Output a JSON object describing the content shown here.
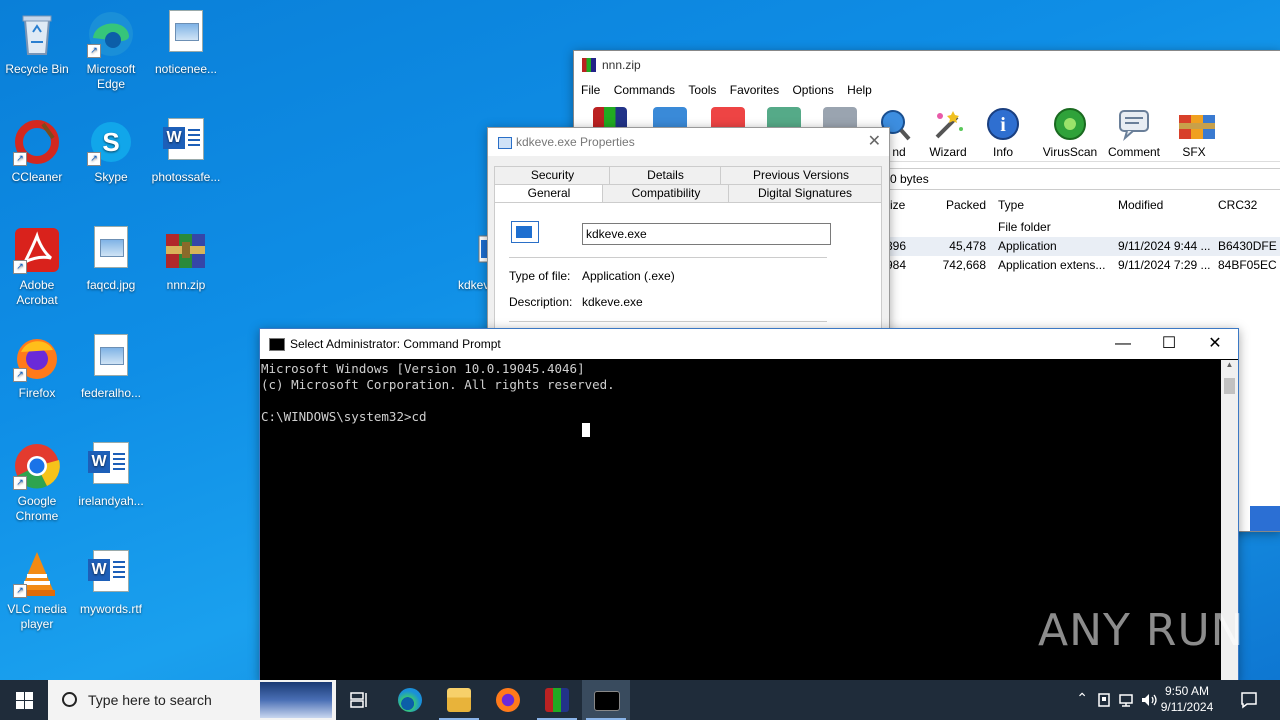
{
  "desktop": {
    "icons": [
      {
        "label": "Recycle Bin"
      },
      {
        "label": "Microsoft Edge"
      },
      {
        "label": "noticenee..."
      },
      {
        "label": "CCleaner"
      },
      {
        "label": "Skype"
      },
      {
        "label": "photossafe..."
      },
      {
        "label": "Adobe Acrobat"
      },
      {
        "label": "faqcd.jpg"
      },
      {
        "label": "nnn.zip"
      },
      {
        "label": "Firefox"
      },
      {
        "label": "federalho..."
      },
      {
        "label": "Google Chrome"
      },
      {
        "label": "irelandyah..."
      },
      {
        "label": "VLC media player"
      },
      {
        "label": "mywords.rtf"
      },
      {
        "label": "kdkev"
      }
    ]
  },
  "winrar": {
    "title": "nnn.zip",
    "menu": [
      "File",
      "Commands",
      "Tools",
      "Favorites",
      "Options",
      "Help"
    ],
    "toolbar": [
      {
        "label": "nd",
        "icon": "find-icon"
      },
      {
        "label": "Wizard",
        "icon": "wizard-icon"
      },
      {
        "label": "Info",
        "icon": "info-icon"
      },
      {
        "label": "VirusScan",
        "icon": "virusscan-icon"
      },
      {
        "label": "Comment",
        "icon": "comment-icon"
      },
      {
        "label": "SFX",
        "icon": "sfx-icon"
      }
    ],
    "address": "0 bytes",
    "columns": [
      "ize",
      "Packed",
      "Type",
      "Modified",
      "CRC32"
    ],
    "rows": [
      {
        "size": "",
        "packed": "",
        "type": "File folder",
        "modified": "",
        "crc": ""
      },
      {
        "size": "396",
        "packed": "45,478",
        "type": "Application",
        "modified": "9/11/2024 9:44 ...",
        "crc": "B6430DFE"
      },
      {
        "size": "984",
        "packed": "742,668",
        "type": "Application extens...",
        "modified": "9/11/2024 7:29 ...",
        "crc": "84BF05EC"
      }
    ]
  },
  "props": {
    "title": "kdkeve.exe Properties",
    "tabs_row1": [
      "Security",
      "Details",
      "Previous Versions"
    ],
    "tabs_row2": [
      "General",
      "Compatibility",
      "Digital Signatures"
    ],
    "filename": "kdkeve.exe",
    "type_label": "Type of file:",
    "type_value": "Application (.exe)",
    "desc_label": "Description:",
    "desc_value": "kdkeve.exe"
  },
  "cmd": {
    "title": "Select Administrator: Command Prompt",
    "lines": [
      "Microsoft Windows [Version 10.0.19045.4046]",
      "(c) Microsoft Corporation. All rights reserved.",
      "",
      "C:\\WINDOWS\\system32>cd"
    ]
  },
  "watermark": "ANY RUN",
  "taskbar": {
    "search_placeholder": "Type here to search",
    "time": "9:50 AM",
    "date": "9/11/2024"
  }
}
